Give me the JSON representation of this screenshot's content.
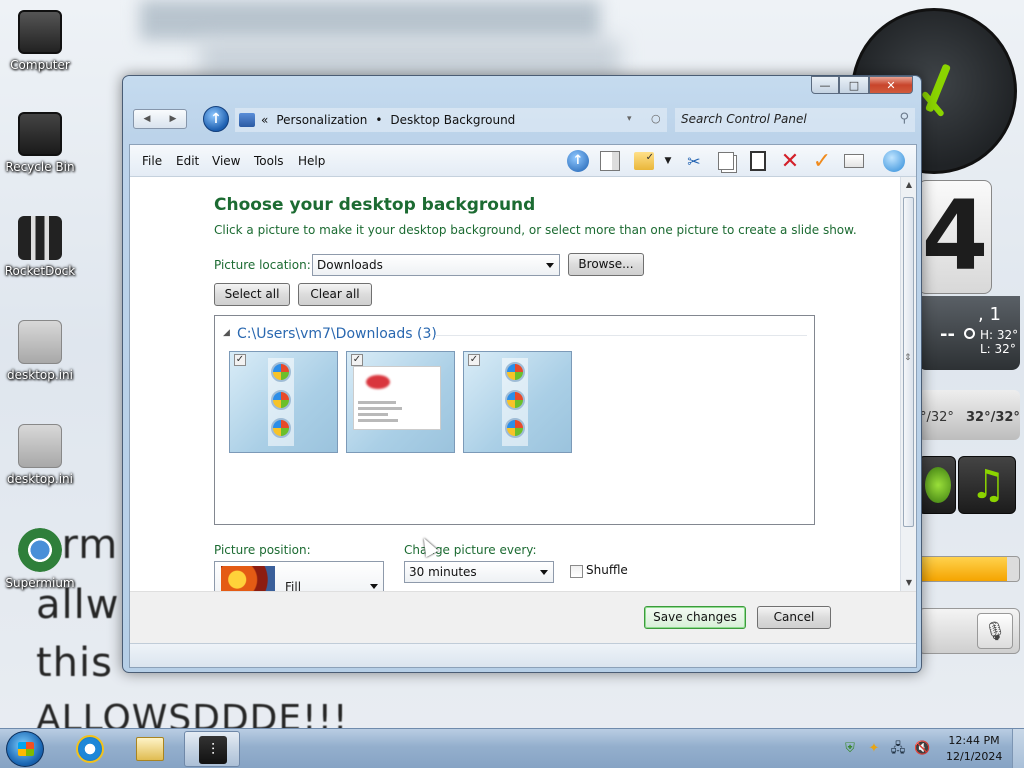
{
  "desktop": {
    "icons": [
      {
        "label": "Computer"
      },
      {
        "label": "Recycle Bin"
      },
      {
        "label": "RocketDock"
      },
      {
        "label": "desktop.ini"
      },
      {
        "label": "desktop.ini"
      },
      {
        "label": "Supermium"
      }
    ],
    "wallpaper_text": [
      "orm",
      "allw",
      "this",
      "ALLOWSDDDE!!!"
    ],
    "gadgets": {
      "flip_digit": "4",
      "weather_day": ", 1",
      "weather_h": "H: 32°",
      "weather_l": "L: 32°",
      "weather_dash": "--",
      "temp_a": "°/32°",
      "temp_b": "32°/32°",
      "music_icon": "music-note-icon",
      "volume_level_percent": 88
    }
  },
  "window": {
    "controls": {
      "minimize": "—",
      "maximize": "□",
      "close": "✕"
    },
    "address": {
      "chevrons": "«",
      "crumb_1": "Personalization",
      "separator": "•",
      "crumb_2": "Desktop Background",
      "dropdown_arrow": "▾",
      "refresh": "○"
    },
    "search_placeholder": "Search Control Panel",
    "menu": [
      "File",
      "Edit",
      "View",
      "Tools",
      "Help"
    ],
    "toolbar_icons": [
      "up-icon",
      "preview-pane-icon",
      "folder-check-icon",
      "cut-icon",
      "copy-icon",
      "paste-icon",
      "delete-icon",
      "checkmark-icon",
      "email-icon",
      "globe-icon"
    ]
  },
  "page": {
    "title": "Choose your desktop background",
    "subtitle": "Click a picture to make it your desktop background, or select more than one picture to create a slide show.",
    "picture_location_label": "Picture location:",
    "picture_location_value": "Downloads",
    "browse_label": "Browse...",
    "select_all_label": "Select all",
    "clear_all_label": "Clear all",
    "group_header": "C:\\Users\\vm7\\Downloads (3)",
    "pictures": [
      {
        "checked": true,
        "kind": "windows-orbs"
      },
      {
        "checked": true,
        "kind": "document"
      },
      {
        "checked": true,
        "kind": "windows-orbs"
      }
    ],
    "picture_position_label": "Picture position:",
    "picture_position_value": "Fill",
    "change_every_label": "Change picture every:",
    "change_every_value": "30 minutes",
    "shuffle_label": "Shuffle",
    "save_label": "Save changes",
    "cancel_label": "Cancel"
  },
  "taskbar": {
    "time": "12:44 PM",
    "date": "12/1/2024"
  }
}
